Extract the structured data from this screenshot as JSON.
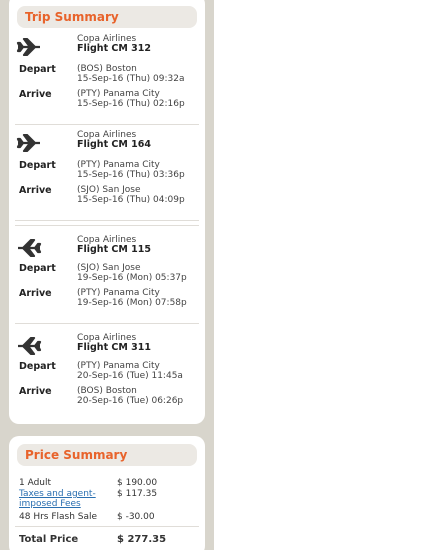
{
  "trip_summary": {
    "title": "Trip Summary",
    "depart_label": "Depart",
    "arrive_label": "Arrive",
    "segments": [
      {
        "direction": "outbound",
        "airline": "Copa Airlines",
        "flight": "Flight CM 312",
        "depart_place": "(BOS) Boston",
        "depart_time": "15-Sep-16 (Thu) 09:32a",
        "arrive_place": "(PTY) Panama City",
        "arrive_time": "15-Sep-16 (Thu) 02:16p"
      },
      {
        "direction": "outbound",
        "airline": "Copa Airlines",
        "flight": "Flight CM 164",
        "depart_place": "(PTY) Panama City",
        "depart_time": "15-Sep-16 (Thu) 03:36p",
        "arrive_place": "(SJO) San Jose",
        "arrive_time": "15-Sep-16 (Thu) 04:09p"
      },
      {
        "direction": "return",
        "airline": "Copa Airlines",
        "flight": "Flight CM 115",
        "depart_place": "(SJO) San Jose",
        "depart_time": "19-Sep-16 (Mon) 05:37p",
        "arrive_place": "(PTY) Panama City",
        "arrive_time": "19-Sep-16 (Mon) 07:58p"
      },
      {
        "direction": "return",
        "airline": "Copa Airlines",
        "flight": "Flight CM 311",
        "depart_place": "(PTY) Panama City",
        "depart_time": "20-Sep-16 (Tue) 11:45a",
        "arrive_place": "(BOS) Boston",
        "arrive_time": "20-Sep-16 (Tue) 06:26p"
      }
    ]
  },
  "price_summary": {
    "title": "Price Summary",
    "adult_label": "1 Adult",
    "adult_value": "$ 190.00",
    "taxes_label_1": "Taxes and agent-",
    "taxes_label_2": "imposed Fees",
    "taxes_value": "$ 117.35",
    "sale_label": "48 Hrs Flash Sale",
    "sale_value": "$ -30.00",
    "total_label": "Total Price",
    "total_value": "$ 277.35"
  },
  "colors": {
    "accent": "#e8632b",
    "sidebar_bg": "#d8d5cc",
    "link": "#2a6fb0"
  }
}
